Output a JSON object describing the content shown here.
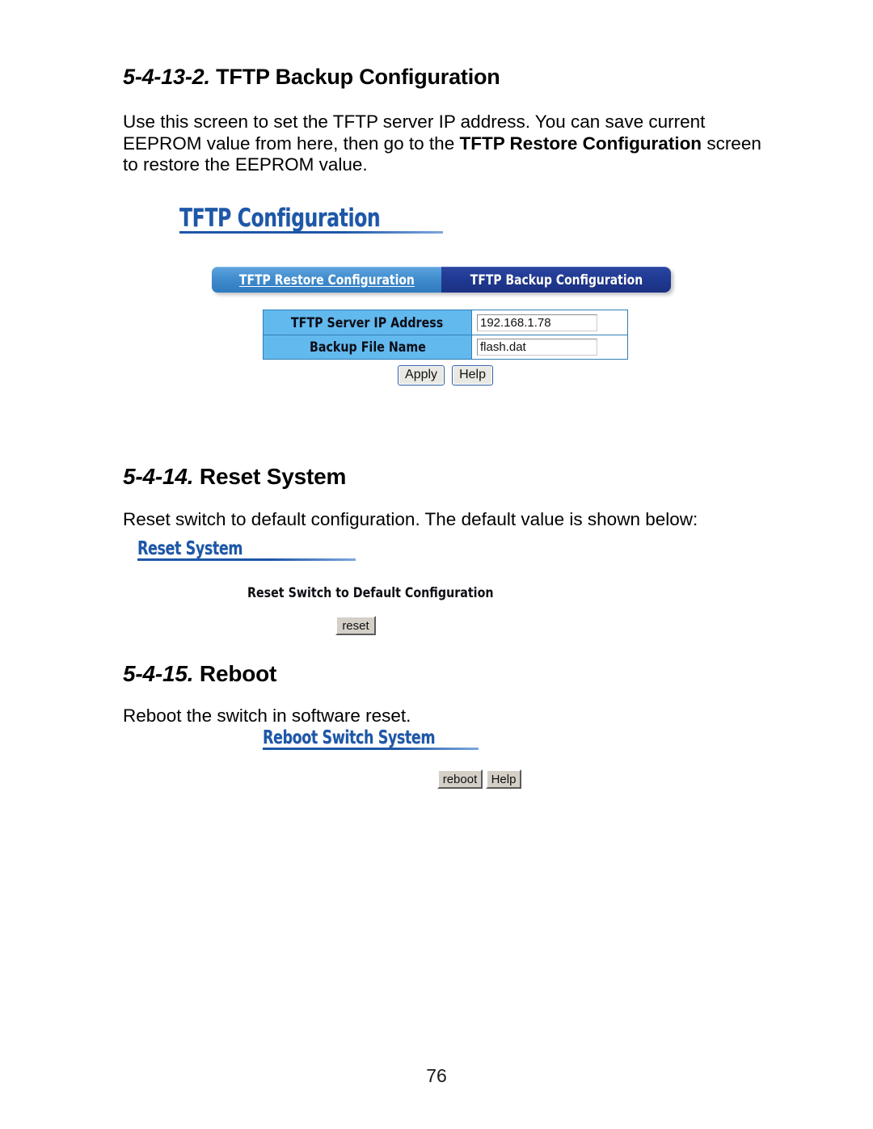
{
  "document": {
    "page_number": "76",
    "sections": [
      {
        "heading_number": "5-4-13-2.",
        "heading_title": "TFTP Backup Configuration",
        "paragraph_before": "Use this screen to set the TFTP server IP address. You can save current EEPROM value from here, then go to the ",
        "paragraph_bold": "TFTP Restore Configuration",
        "paragraph_after": " screen to restore the EEPROM value."
      },
      {
        "heading_number": "5-4-14.",
        "heading_title": "Reset System",
        "paragraph": "Reset switch to default configuration.  The default value is shown below:"
      },
      {
        "heading_number": "5-4-15.",
        "heading_title": "Reboot",
        "paragraph": "Reboot the switch in software reset."
      }
    ]
  },
  "tftp_screenshot": {
    "title": "TFTP Configuration",
    "tabs": [
      {
        "label": "TFTP Restore Configuration",
        "active": false
      },
      {
        "label": "TFTP Backup Configuration",
        "active": true
      }
    ],
    "fields": [
      {
        "label": "TFTP Server IP Address",
        "value": "192.168.1.78"
      },
      {
        "label": "Backup File Name",
        "value": "flash.dat"
      }
    ],
    "buttons": [
      {
        "label": "Apply"
      },
      {
        "label": "Help"
      }
    ]
  },
  "reset_screenshot": {
    "title": "Reset System",
    "note": "Reset Switch to Default Configuration",
    "button_label": "reset"
  },
  "reboot_screenshot": {
    "title": "Reboot Switch System",
    "button_label": "reboot",
    "help_label": "Help"
  },
  "colors": {
    "web_title_blue": "#1d57a8",
    "tab_inactive_blue": "#3f8ccd",
    "tab_active_navy": "#1f3891",
    "table_label_blue": "#62b9ee",
    "table_border_blue": "#2f7fb5",
    "gray_button": "#d4d0c8"
  }
}
